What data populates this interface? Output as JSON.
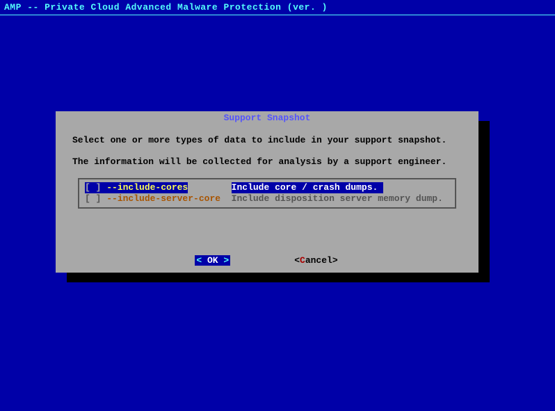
{
  "header": {
    "title": "AMP -- Private Cloud Advanced Malware Protection (ver. )"
  },
  "dialog": {
    "title": "Support Snapshot",
    "line1": "Select one or more types of data to include in your support snapshot.",
    "line2": "The information will be collected for analysis by a support engineer.",
    "options": [
      {
        "check": "[ ] ",
        "flag": "--include-cores",
        "gap": "        ",
        "desc": "Include core / crash dumps. ",
        "selected": true
      },
      {
        "check": "[ ] ",
        "flag": "--include-server-core",
        "gap": "  ",
        "desc": "Include disposition server memory dump.",
        "selected": false
      }
    ],
    "buttons": {
      "ok_arrow_l": "<",
      "ok_label": " OK ",
      "ok_arrow_r": ">",
      "cancel_bracket_l": "<",
      "cancel_hotkey": "C",
      "cancel_rest": "ancel",
      "cancel_bracket_r": ">"
    }
  }
}
